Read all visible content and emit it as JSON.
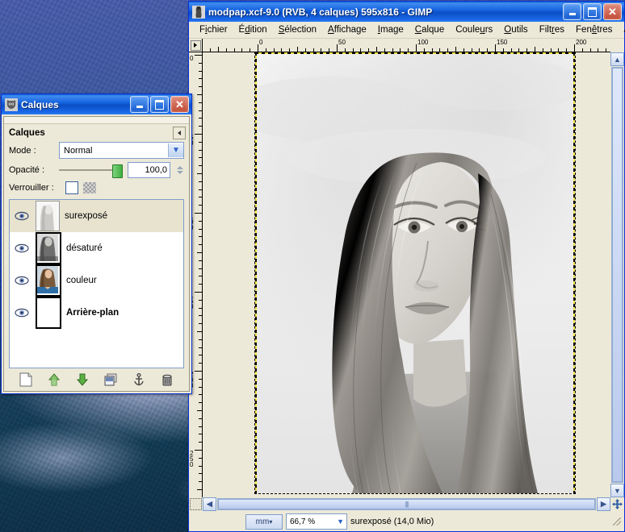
{
  "gimp": {
    "title": "modpap.xcf-9.0 (RVB, 4 calques) 595x816 - GIMP",
    "window_buttons": {
      "minimize": "_",
      "maximize": "□",
      "close": "✕"
    },
    "menu": [
      {
        "pre": "F",
        "accel": "i",
        "post": "chier",
        "name": "menu-fichier"
      },
      {
        "pre": "É",
        "accel": "d",
        "post": "ition",
        "name": "menu-edition"
      },
      {
        "pre": "",
        "accel": "S",
        "post": "élection",
        "name": "menu-selection"
      },
      {
        "pre": "",
        "accel": "A",
        "post": "ffichage",
        "name": "menu-affichage"
      },
      {
        "pre": "",
        "accel": "I",
        "post": "mage",
        "name": "menu-image"
      },
      {
        "pre": "",
        "accel": "C",
        "post": "alque",
        "name": "menu-calque"
      },
      {
        "pre": "Coule",
        "accel": "u",
        "post": "rs",
        "name": "menu-couleurs"
      },
      {
        "pre": "",
        "accel": "O",
        "post": "utils",
        "name": "menu-outils"
      },
      {
        "pre": "Filt",
        "accel": "r",
        "post": "es",
        "name": "menu-filtres"
      },
      {
        "pre": "Fen",
        "accel": "ê",
        "post": "tres",
        "name": "menu-fenetres"
      },
      {
        "pre": "Aid",
        "accel": "e",
        "post": "",
        "name": "menu-aide"
      }
    ],
    "ruler": {
      "horizontal_labels": [
        "0",
        "50",
        "100",
        "150",
        "200"
      ],
      "vertical_labels": [
        "0",
        "50",
        "100",
        "150",
        "200",
        "250"
      ],
      "unit": "mm"
    },
    "statusbar": {
      "unit": "mm",
      "zoom": "66,7 %",
      "text": "surexposé (14,0 Mio)"
    }
  },
  "layers_dialog": {
    "title": "Calques",
    "window_buttons": {
      "minimize": "_",
      "maximize": "□",
      "close": "✕"
    },
    "header_title": "Calques",
    "mode_label": "Mode :",
    "mode_value": "Normal",
    "opacity_label": "Opacité :",
    "opacity_value": "100,0",
    "lock_label": "Verrouiller :",
    "layers": [
      {
        "name": "surexposé",
        "selected": true,
        "bold": false,
        "visible": true,
        "thumb": "washed-portrait"
      },
      {
        "name": "désaturé",
        "selected": false,
        "bold": false,
        "visible": true,
        "thumb": "bw-portrait"
      },
      {
        "name": "couleur",
        "selected": false,
        "bold": false,
        "visible": true,
        "thumb": "color-portrait"
      },
      {
        "name": "Arrière-plan",
        "selected": false,
        "bold": true,
        "visible": true,
        "thumb": "white"
      }
    ],
    "toolbar": [
      {
        "label": "Nouveau calque",
        "name": "new-layer-icon"
      },
      {
        "label": "Monter le calque",
        "name": "raise-layer-icon"
      },
      {
        "label": "Descendre le calque",
        "name": "lower-layer-icon"
      },
      {
        "label": "Dupliquer le calque",
        "name": "duplicate-layer-icon"
      },
      {
        "label": "Ancrer le calque",
        "name": "anchor-layer-icon"
      },
      {
        "label": "Supprimer le calque",
        "name": "delete-layer-icon"
      }
    ]
  },
  "colors": {
    "titlebar_blue": "#0b4fc4",
    "window_face": "#ece9d8",
    "canvas_pad": "#ece9d8",
    "selection_yellow": "#f2e54c",
    "selected_row": "#e7e3cf"
  }
}
